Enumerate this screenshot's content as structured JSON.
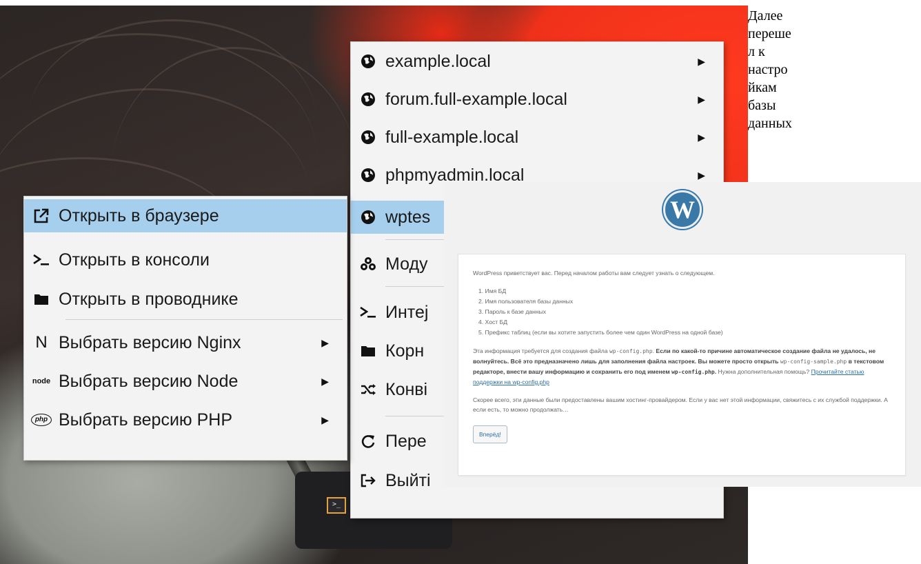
{
  "side_text": [
    "Далее",
    "переше",
    "л к",
    "настро",
    "йкам",
    "базы",
    "данных"
  ],
  "colors": {
    "highlight": "#a6cfee",
    "accent_red": "#f0311a",
    "wp_blue": "#3a78a8"
  },
  "sites_menu": {
    "items": [
      {
        "label": "example.local",
        "icon": "globe-icon",
        "has_submenu": true
      },
      {
        "label": "forum.full-example.local",
        "icon": "globe-icon",
        "has_submenu": true
      },
      {
        "label": "full-example.local",
        "icon": "globe-icon",
        "has_submenu": true
      },
      {
        "label": "phpmyadmin.local",
        "icon": "globe-icon",
        "has_submenu": true
      },
      {
        "label": "wptes",
        "icon": "globe-icon",
        "has_submenu": true,
        "selected": true
      },
      {
        "label": "Моду",
        "icon": "modules-icon"
      },
      {
        "label": "Интеј",
        "icon": "terminal-icon"
      },
      {
        "label": "Корн",
        "icon": "folder-icon"
      },
      {
        "label": "Конві",
        "icon": "shuffle-icon"
      },
      {
        "label": "Пере",
        "icon": "restart-icon"
      },
      {
        "label": "Выйті",
        "icon": "exit-icon"
      }
    ]
  },
  "actions_menu": {
    "items": [
      {
        "label": "Открыть в браузере",
        "icon": "external-link-icon",
        "highlighted": true
      },
      {
        "label": "Открыть в консоли",
        "icon": "terminal-icon"
      },
      {
        "label": "Открыть в проводнике",
        "icon": "folder-icon"
      },
      {
        "label": "Выбрать версию Nginx",
        "icon": "nginx-icon",
        "icon_text": "N",
        "has_submenu": true
      },
      {
        "label": "Выбрать версию Node",
        "icon": "node-icon",
        "icon_text": "node",
        "has_submenu": true
      },
      {
        "label": "Выбрать версию PHP",
        "icon": "php-icon",
        "icon_text": "php",
        "has_submenu": true
      }
    ]
  },
  "taskbar": {
    "terminal_text": ">_"
  },
  "wordpress": {
    "logo_letter": "W",
    "intro": "WordPress приветствует вас. Перед началом работы вам следует узнать о следующем.",
    "list": [
      "1. Имя БД",
      "2. Имя пользователя базы данных",
      "3. Пароль к базе данных",
      "4. Хост БД",
      "5. Префикс таблиц (если вы хотите запустить более чем один WordPress на одной базе)"
    ],
    "para2_a": "Эта информация требуется для создания файла",
    "para2_code1": "wp-config.php",
    "para2_bold1": "Если по какой-то причине автоматическое создание файла не удалось, не волнуйтесь. Всё это предназначено лишь для заполнения файла настроек. Вы можете просто открыть",
    "para2_code2": "wp-config-sample.php",
    "para2_bold2": "в текстовом редакторе, внести вашу информацию и сохранить его под именем",
    "para2_code3": "wp-config.php",
    "para2_help": "Нужна дополнительная помощь?",
    "para2_link": "Прочитайте статью поддержки на wp-config.php",
    "para3": "Скорее всего, эти данные были предоставлены вашим хостинг-провайдером. Если у вас нет этой информации, свяжитесь с их службой поддержки. А если есть, то можно продолжать…",
    "button": "Вперёд!"
  }
}
